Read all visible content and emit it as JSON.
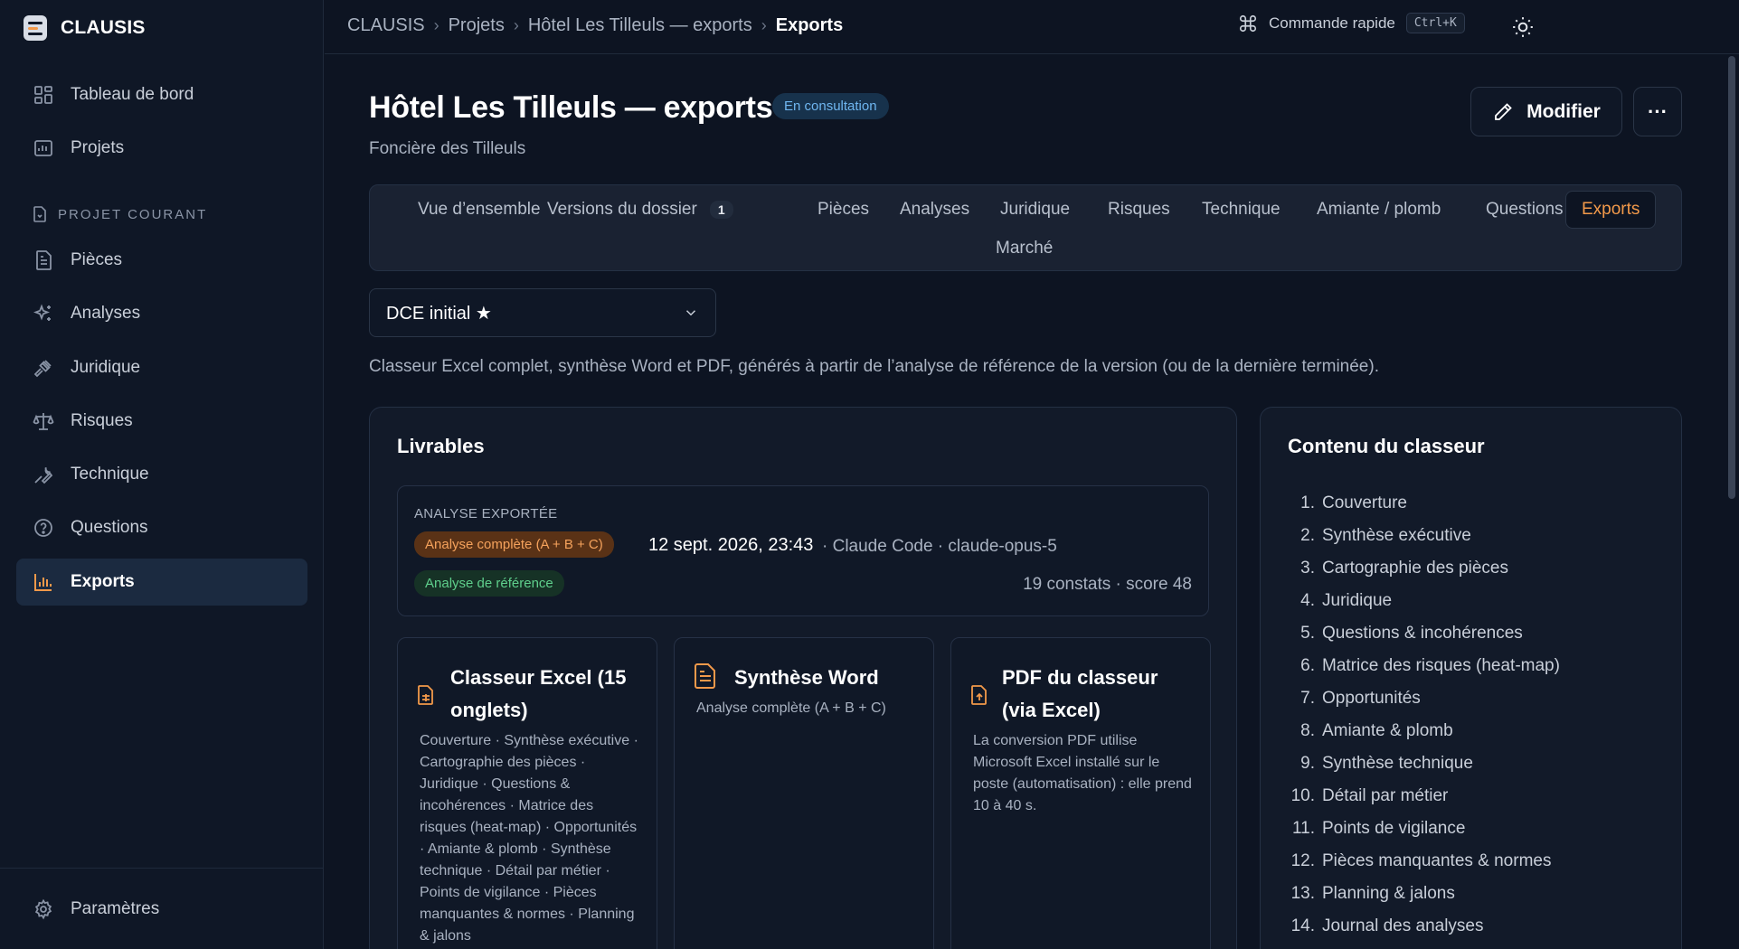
{
  "app": {
    "name": "CLAUSIS"
  },
  "colors": {
    "accent": "#f2994a",
    "background": "#0d1422",
    "sidebar": "#0f1726",
    "info": "#6fb6f0",
    "success": "#5fcf8c"
  },
  "sidebar": {
    "items": [
      {
        "label": "Tableau de bord",
        "icon": "dashboard-icon"
      },
      {
        "label": "Projets",
        "icon": "chart-icon"
      }
    ],
    "section_label": "PROJET COURANT",
    "project_items": [
      {
        "label": "Pièces",
        "icon": "document-icon"
      },
      {
        "label": "Analyses",
        "icon": "sparkles-icon"
      },
      {
        "label": "Juridique",
        "icon": "gavel-icon"
      },
      {
        "label": "Risques",
        "icon": "scale-icon"
      },
      {
        "label": "Technique",
        "icon": "wrench-icon"
      },
      {
        "label": "Questions",
        "icon": "help-circle-icon"
      },
      {
        "label": "Exports",
        "icon": "bar-chart-icon",
        "active": true
      }
    ],
    "footer": {
      "label": "Paramètres",
      "icon": "gear-icon"
    }
  },
  "topbar": {
    "breadcrumb": [
      "CLAUSIS",
      "Projets",
      "Hôtel Les Tilleuls — exports",
      "Exports"
    ],
    "quick_command": "Commande rapide",
    "shortcut": "Ctrl+K"
  },
  "page": {
    "title": "Hôtel Les Tilleuls — exports",
    "status_badge": "En consultation",
    "subtitle": "Foncière des Tilleuls",
    "edit_button": "Modifier",
    "more_button": "···"
  },
  "tabs": [
    {
      "label": "Vue d’ensemble"
    },
    {
      "label": "Versions du dossier",
      "count": "1"
    },
    {
      "label": "Pièces"
    },
    {
      "label": "Analyses"
    },
    {
      "label": "Juridique"
    },
    {
      "label": "Risques"
    },
    {
      "label": "Technique"
    },
    {
      "label": "Amiante / plomb"
    },
    {
      "label": "Questions"
    },
    {
      "label": "Exports",
      "active": true
    },
    {
      "label": "Marché"
    }
  ],
  "version_select": {
    "value": "DCE initial ★"
  },
  "description": "Classeur Excel complet, synthèse Word et PDF, générés à partir de l’analyse de référence de la version (ou de la dernière terminée).",
  "livrables": {
    "title": "Livrables",
    "exported": {
      "label": "ANALYSE EXPORTÉE",
      "type_badge": "Analyse complète (A + B + C)",
      "date": "12 sept. 2026, 23:43",
      "meta": "· Claude Code · claude-opus-5",
      "reference_badge": "Analyse de référence",
      "stats": "19 constats · score 48"
    },
    "cards": [
      {
        "title_line1": "Classeur Excel (15",
        "title_line2": "onglets)",
        "icon": "file-spreadsheet-icon",
        "text": "Couverture · Synthèse exécutive · Cartographie des pièces · Juridique · Questions & incohérences · Matrice des risques (heat-map) · Opportunités · Amiante & plomb · Synthèse technique · Détail par métier · Points de vigilance · Pièces manquantes & normes · Planning & jalons"
      },
      {
        "title_line1": "Synthèse Word",
        "icon": "file-text-icon",
        "text": "Analyse complète (A + B + C)"
      },
      {
        "title_line1": "PDF du classeur",
        "title_line2": "(via Excel)",
        "icon": "file-export-icon",
        "text": "La conversion PDF utilise Microsoft Excel installé sur le poste (automatisation) : elle prend 10 à 40 s."
      }
    ]
  },
  "contenu": {
    "title": "Contenu du classeur",
    "items": [
      "Couverture",
      "Synthèse exécutive",
      "Cartographie des pièces",
      "Juridique",
      "Questions & incohérences",
      "Matrice des risques (heat-map)",
      "Opportunités",
      "Amiante & plomb",
      "Synthèse technique",
      "Détail par métier",
      "Points de vigilance",
      "Pièces manquantes & normes",
      "Planning & jalons",
      "Journal des analyses"
    ]
  }
}
